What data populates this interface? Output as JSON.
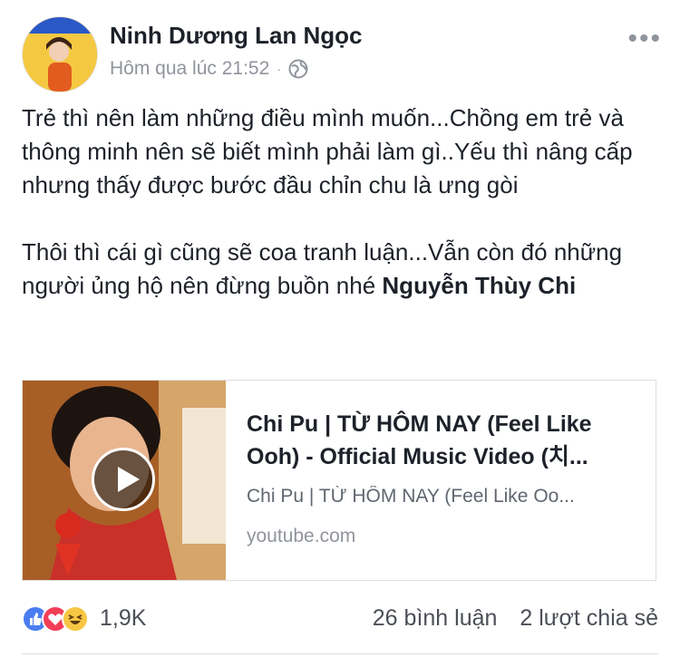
{
  "post": {
    "author": "Ninh Dương Lan Ngọc",
    "timestamp": "Hôm qua lúc 21:52",
    "separator": "·",
    "privacy_icon": "globe-icon",
    "more_label": "•••",
    "text_paragraph_1": "Trẻ thì nên làm những điều mình muốn...Chồng em trẻ và thông minh nên sẽ biết mình phải làm gì..Yếu thì nâng cấp nhưng thấy được bước đầu chỉn chu là ưng gòi",
    "text_paragraph_2_prefix": "Thôi thì cái gì cũng sẽ coa tranh luận...Vẫn còn đó những người ủng hộ nên đừng buồn nhé ",
    "mention": "Nguyễn Thùy Chi"
  },
  "link_card": {
    "title": "Chi Pu | TỪ HÔM NAY (Feel Like Ooh) - Official Music Video (치...",
    "description": "Chi Pu | TỪ HÔM NAY (Feel Like Oo...",
    "domain": "youtube.com",
    "thumbnail_icon": "play-icon"
  },
  "engagement": {
    "reactions": [
      "like-icon",
      "love-icon",
      "haha-icon"
    ],
    "reaction_count": "1,9K",
    "comments": "26 bình luận",
    "shares": "2 lượt chia sẻ"
  },
  "colors": {
    "like": "#4a7df0",
    "love": "#f33e58",
    "haha": "#f7c644",
    "secondary_text": "#90949c"
  }
}
